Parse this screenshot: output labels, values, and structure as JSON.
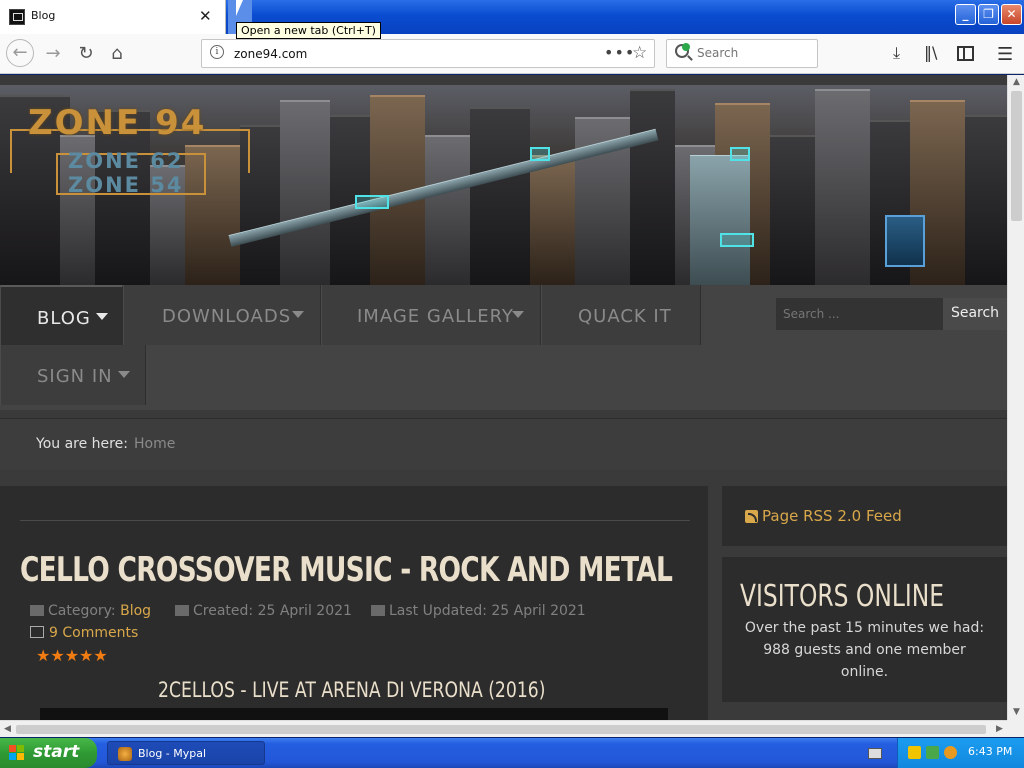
{
  "browser": {
    "tab_title": "Blog",
    "tab_close": "✕",
    "tooltip": "Open a new tab (Ctrl+T)",
    "url": "zone94.com",
    "search_placeholder": "Search",
    "window_buttons": {
      "minimize": "_",
      "maximize": "❐",
      "close": "✕"
    }
  },
  "site": {
    "logo_main": "ZONE 94",
    "logo_sub1": "ZONE 62",
    "logo_sub2": "ZONE 54",
    "menu": {
      "blog": "BLOG",
      "downloads": "DOWNLOADS",
      "image_gallery": "IMAGE GALLERY",
      "quack_it": "QUACK IT",
      "sign_in": "SIGN IN"
    },
    "search_placeholder": "Search ...",
    "search_button": "Search",
    "breadcrumb": {
      "label": "You are here:",
      "home": "Home"
    }
  },
  "article": {
    "title": "CELLO CROSSOVER MUSIC - ROCK AND METAL",
    "category_label": "Category:",
    "category": "Blog",
    "created": "Created: 25 April 2021",
    "updated": "Last Updated: 25 April 2021",
    "comments": "9 Comments",
    "rating_stars": "★★★★★",
    "rating_value": 5,
    "video_title": "2CELLOS - LIVE AT ARENA DI VERONA (2016)"
  },
  "sidebar": {
    "rss": "Page RSS 2.0 Feed",
    "visitors_title": "VISITORS ONLINE",
    "visitors_text": "Over the past 15 minutes we had: 988 guests and one member online."
  },
  "taskbar": {
    "start": "start",
    "task": "Blog - Mypal",
    "clock": "6:43 PM"
  },
  "colors": {
    "accent": "#d9a84a",
    "title_text": "#eadfca",
    "rating": "#f07c12",
    "xp_blue": "#245ee0",
    "start_green": "#2f9a33"
  }
}
